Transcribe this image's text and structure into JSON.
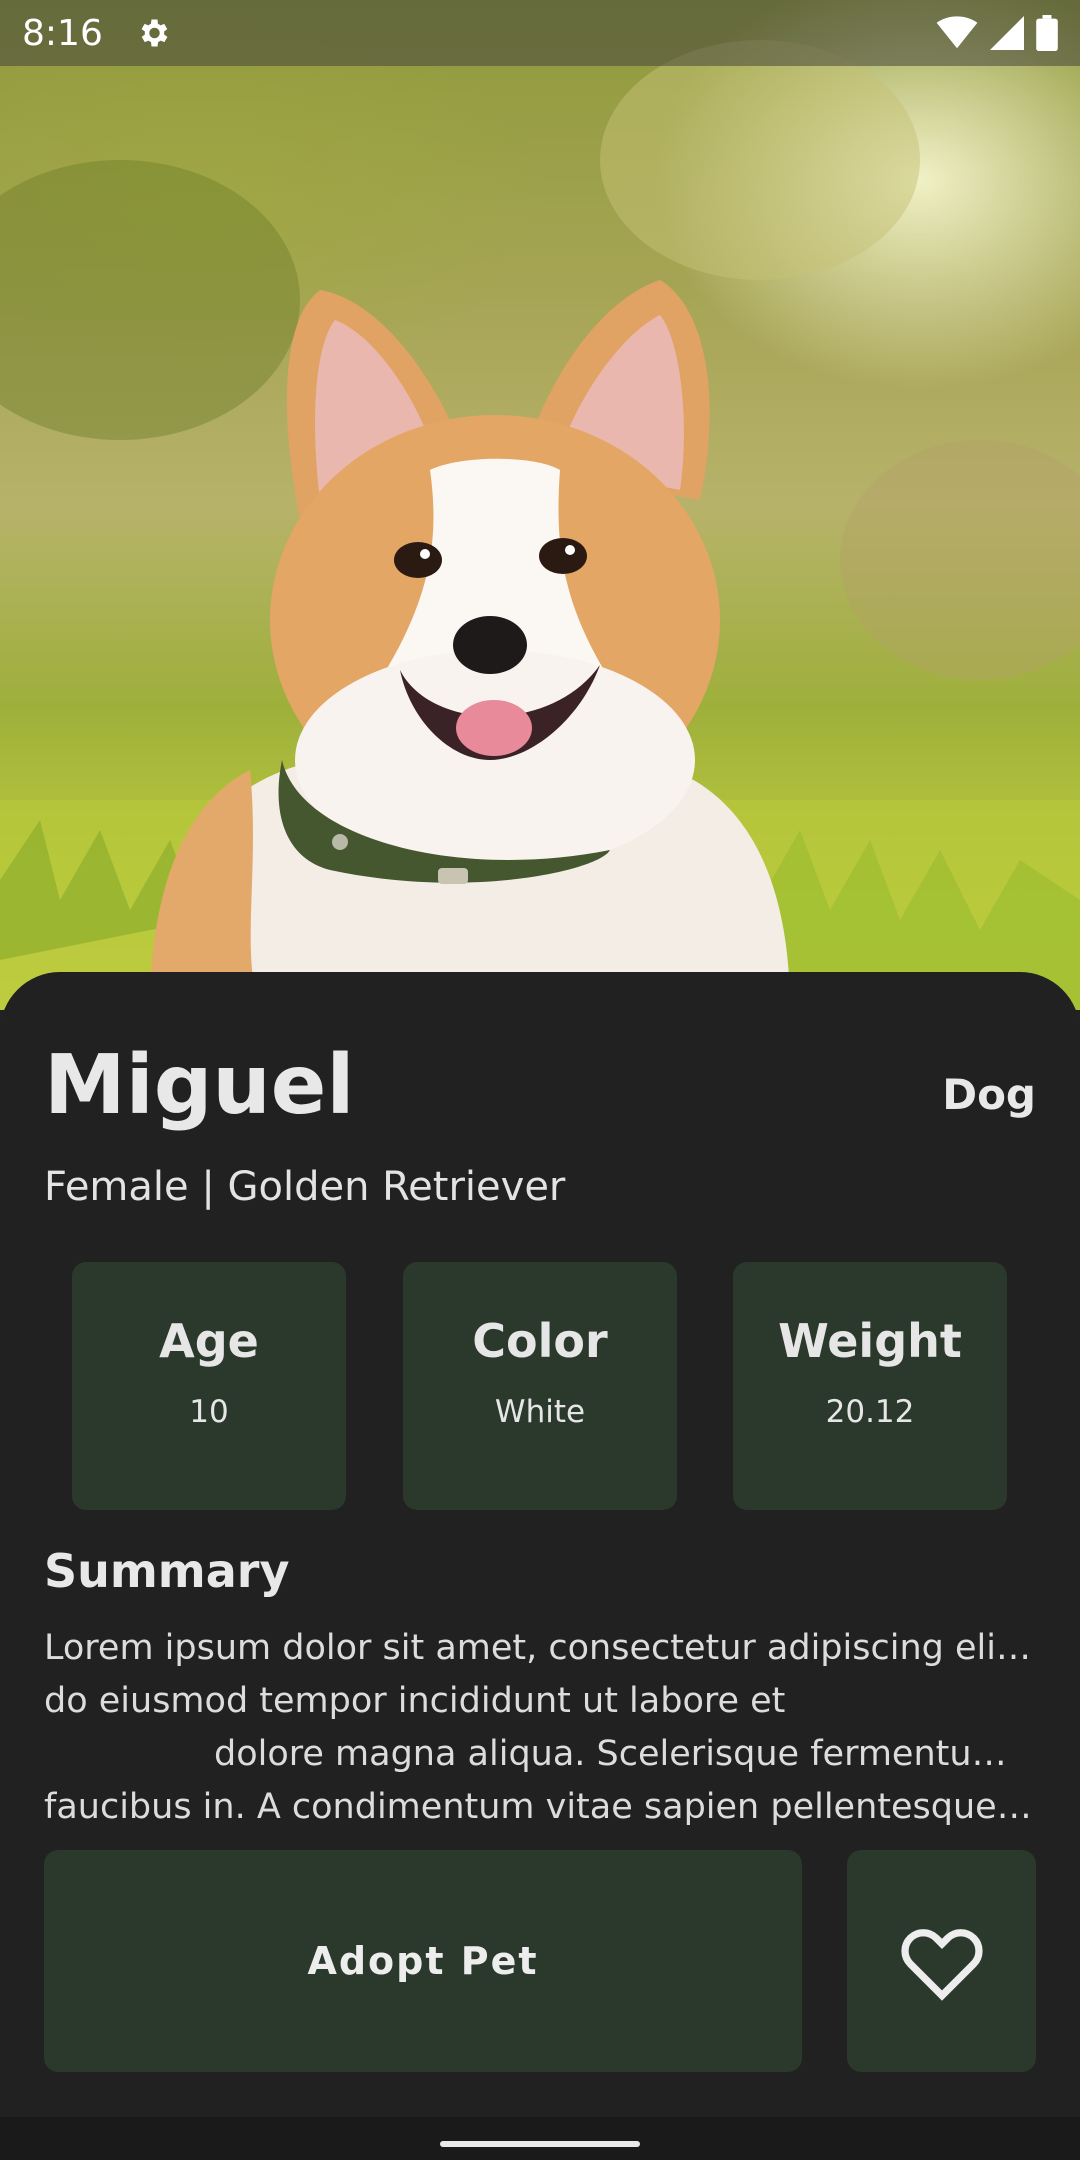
{
  "status_bar": {
    "time": "8:16",
    "icons": [
      "settings-gear-icon",
      "wifi-icon",
      "signal-icon",
      "battery-icon"
    ]
  },
  "hero": {
    "subject": "corgi-photo"
  },
  "pet": {
    "name": "Miguel",
    "type": "Dog",
    "subtitle": "Female | Golden Retriever",
    "stats": {
      "age_label": "Age",
      "age_value": "10",
      "color_label": "Color",
      "color_value": "White",
      "weight_label": "Weight",
      "weight_value": "20.12"
    },
    "summary_title": "Summary",
    "summary_lines": [
      "Lorem ipsum dolor sit amet, consectetur adipiscing elit, sed",
      "do eiusmod tempor incididunt ut labore et",
      "dolore magna aliqua. Scelerisque fermentum dui",
      "faucibus in. A condimentum vitae sapien pellentesque hab…"
    ]
  },
  "actions": {
    "adopt_label": "Adopt Pet",
    "favorite_icon": "heart-outline-icon"
  },
  "colors": {
    "card_background": "#212121",
    "stat_background": "#2b382c",
    "text": "#e8e8e8"
  }
}
